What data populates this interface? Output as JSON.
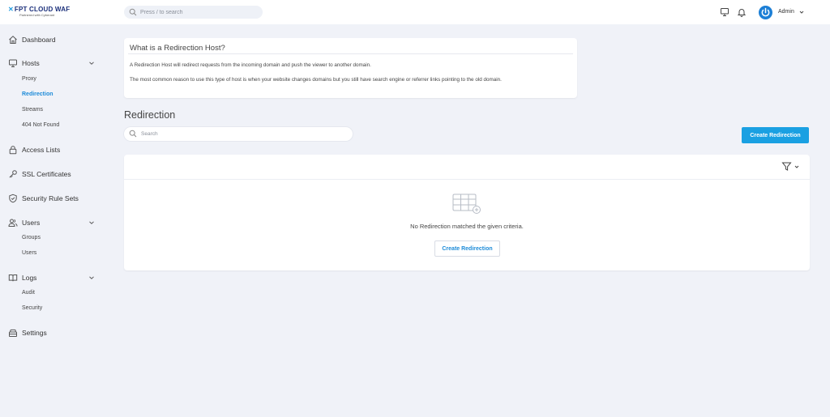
{
  "header": {
    "logo_main": "FPT CLOUD WAF",
    "logo_sub": "Partnered with Cyberant",
    "search_placeholder": "Press / to search",
    "user_name": "Admin"
  },
  "sidebar": {
    "dashboard": "Dashboard",
    "hosts": "Hosts",
    "hosts_sub": [
      "Proxy",
      "Redirection",
      "Streams",
      "404 Not Found"
    ],
    "access_lists": "Access Lists",
    "ssl": "SSL Certificates",
    "security_rules": "Security Rule Sets",
    "users": "Users",
    "users_sub": [
      "Groups",
      "Users"
    ],
    "logs": "Logs",
    "logs_sub": [
      "Audit",
      "Security"
    ],
    "settings": "Settings",
    "active": "Redirection"
  },
  "info": {
    "title": "What is a Redirection Host?",
    "p1": "A Redirection Host will redirect requests from the incoming domain and push the viewer to another domain.",
    "p2": "The most common reason to use this type of host is when your website changes domains but you still have search engine or referrer links pointing to the old domain."
  },
  "main": {
    "title": "Redirection",
    "search_placeholder": "Search",
    "create_label": "Create Redirection",
    "empty_text": "No Redirection matched the given criteria.",
    "empty_create_label": "Create Redirection"
  },
  "colors": {
    "accent": "#1aa0e2",
    "active_link": "#1d8bd8",
    "background": "#f0f2f8"
  }
}
